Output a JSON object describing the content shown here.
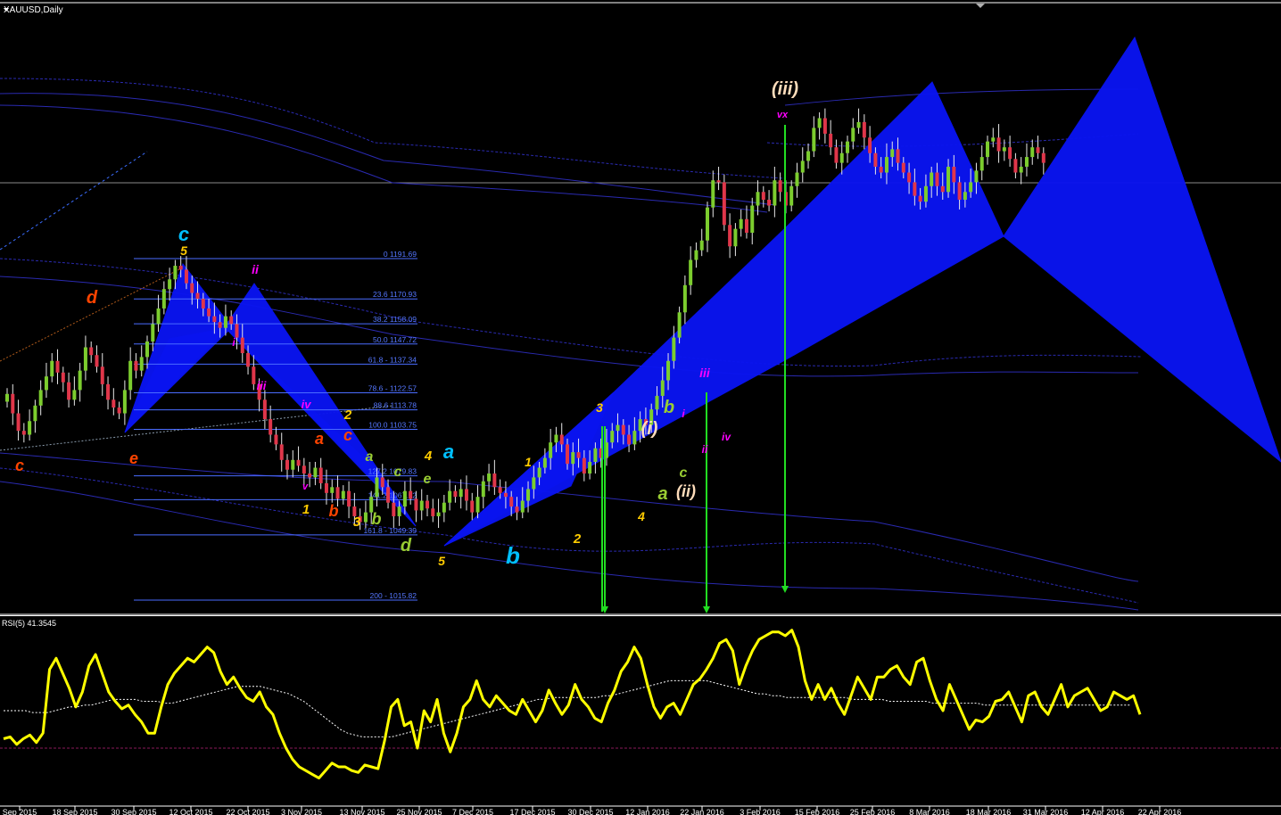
{
  "chart_data": {
    "type": "candlestick",
    "title": "XAUUSD,Daily",
    "symbol": "XAUUSD",
    "timeframe": "Daily",
    "ylim": [
      1000,
      1300
    ],
    "current_price": 1240,
    "x_tick_labels": [
      "Sep 2015",
      "18 Sep 2015",
      "30 Sep 2015",
      "12 Oct 2015",
      "22 Oct 2015",
      "3 Nov 2015",
      "13 Nov 2015",
      "25 Nov 2015",
      "7 Dec 2015",
      "17 Dec 2015",
      "30 Dec 2015",
      "12 Jan 2016",
      "22 Jan 2016",
      "3 Feb 2016",
      "15 Feb 2016",
      "25 Feb 2016",
      "8 Mar 2016",
      "18 Mar 2016",
      "31 Mar 2016",
      "12 Apr 2016",
      "22 Apr 2016"
    ],
    "fib_levels": [
      {
        "label": "0 1191.69",
        "value": 1191.69
      },
      {
        "label": "23.6 1170.93",
        "value": 1170.93
      },
      {
        "label": "38.2 1158.09",
        "value": 1158.09
      },
      {
        "label": "50.0 1147.72",
        "value": 1147.72
      },
      {
        "label": "61.8 - 1137.34",
        "value": 1137.34
      },
      {
        "label": "78.6 - 1122.57",
        "value": 1122.57
      },
      {
        "label": "88.6 1113.78",
        "value": 1113.78
      },
      {
        "label": "100.0 1103.75",
        "value": 1103.75
      },
      {
        "label": "127.2 1079.83",
        "value": 1079.83
      },
      {
        "label": "141.2 1067.52",
        "value": 1067.52
      },
      {
        "label": "161.8 - 1049.39",
        "value": 1049.39
      },
      {
        "label": "200 - 1015.82",
        "value": 1015.82
      }
    ],
    "candles_close": [
      1122,
      1112,
      1103,
      1101,
      1108,
      1116,
      1124,
      1131,
      1139,
      1133,
      1128,
      1119,
      1124,
      1134,
      1146,
      1142,
      1136,
      1127,
      1119,
      1115,
      1112,
      1124,
      1139,
      1134,
      1141,
      1149,
      1158,
      1166,
      1176,
      1181,
      1188,
      1186,
      1179,
      1174,
      1171,
      1166,
      1162,
      1159,
      1156,
      1162,
      1158,
      1151,
      1143,
      1136,
      1127,
      1119,
      1109,
      1101,
      1096,
      1088,
      1083,
      1088,
      1085,
      1081,
      1079,
      1084,
      1076,
      1071,
      1074,
      1068,
      1072,
      1064,
      1059,
      1056,
      1061,
      1069,
      1079,
      1074,
      1066,
      1059,
      1064,
      1072,
      1068,
      1062,
      1067,
      1063,
      1059,
      1061,
      1066,
      1072,
      1069,
      1073,
      1067,
      1061,
      1069,
      1077,
      1081,
      1074,
      1071,
      1069,
      1064,
      1061,
      1067,
      1073,
      1079,
      1084,
      1089,
      1097,
      1101,
      1096,
      1086,
      1092,
      1089,
      1081,
      1087,
      1094,
      1089,
      1097,
      1103,
      1106,
      1101,
      1096,
      1103,
      1109,
      1106,
      1114,
      1121,
      1129,
      1139,
      1151,
      1164,
      1178,
      1191,
      1196,
      1201,
      1218,
      1232,
      1231,
      1209,
      1198,
      1207,
      1212,
      1205,
      1219,
      1226,
      1222,
      1219,
      1232,
      1226,
      1219,
      1229,
      1236,
      1242,
      1247,
      1259,
      1264,
      1256,
      1249,
      1241,
      1246,
      1252,
      1259,
      1262,
      1254,
      1246,
      1239,
      1236,
      1244,
      1248,
      1241,
      1236,
      1231,
      1224,
      1221,
      1229,
      1236,
      1229,
      1226,
      1239,
      1231,
      1222,
      1226,
      1231,
      1237,
      1244,
      1252,
      1254,
      1247,
      1249,
      1243,
      1236,
      1239,
      1244,
      1249,
      1246,
      1241
    ],
    "wave_labels": [
      {
        "text": "c",
        "color": "#ff4400"
      },
      {
        "text": "e",
        "color": "#ff4400"
      },
      {
        "text": "d",
        "color": "#ff4400"
      },
      {
        "text": "c",
        "color": "#00bfff"
      },
      {
        "text": "5",
        "color": "#ffcc00"
      },
      {
        "text": "ii",
        "color": "#ff00ff"
      },
      {
        "text": "i",
        "color": "#ff00ff"
      },
      {
        "text": "iii",
        "color": "#ff00ff"
      },
      {
        "text": "iv",
        "color": "#ff00ff"
      },
      {
        "text": "v",
        "color": "#ff00ff"
      },
      {
        "text": "1",
        "color": "#ffcc00"
      },
      {
        "text": "a",
        "color": "#ff4400"
      },
      {
        "text": "b",
        "color": "#ff4400"
      },
      {
        "text": "c",
        "color": "#ff4400"
      },
      {
        "text": "2",
        "color": "#ffcc00"
      },
      {
        "text": "3",
        "color": "#ffcc00"
      },
      {
        "text": "a",
        "color": "#99cc33"
      },
      {
        "text": "b",
        "color": "#99cc33"
      },
      {
        "text": "c",
        "color": "#99cc33"
      },
      {
        "text": "d",
        "color": "#99cc33"
      },
      {
        "text": "e",
        "color": "#99cc33"
      },
      {
        "text": "4",
        "color": "#ffcc00"
      },
      {
        "text": "5",
        "color": "#ffcc00"
      },
      {
        "text": "a",
        "color": "#00bfff"
      },
      {
        "text": "b",
        "color": "#00bfff"
      },
      {
        "text": "1",
        "color": "#ffcc00"
      },
      {
        "text": "2",
        "color": "#ffcc00"
      },
      {
        "text": "3",
        "color": "#ffcc00"
      },
      {
        "text": "4",
        "color": "#ffcc00"
      },
      {
        "text": "(i)",
        "color": "#ffddbb"
      },
      {
        "text": "b",
        "color": "#99cc33"
      },
      {
        "text": "a",
        "color": "#99cc33"
      },
      {
        "text": "c",
        "color": "#99cc33"
      },
      {
        "text": "(ii)",
        "color": "#ffddbb"
      },
      {
        "text": "i",
        "color": "#ff00ff"
      },
      {
        "text": "ii",
        "color": "#ff00ff"
      },
      {
        "text": "iii",
        "color": "#ff00ff"
      },
      {
        "text": "iv",
        "color": "#ff00ff"
      },
      {
        "text": "vx",
        "color": "#ff00ff"
      },
      {
        "text": "(iii)",
        "color": "#ffddbb"
      }
    ],
    "rsi": {
      "label": "RSI(5) 41.3545",
      "period": 5,
      "last_value": 41.3545,
      "ylim": [
        0,
        100
      ],
      "level": 30,
      "values": [
        35,
        36,
        32,
        35,
        37,
        33,
        38,
        72,
        78,
        70,
        62,
        52,
        60,
        74,
        80,
        70,
        60,
        55,
        51,
        53,
        48,
        44,
        38,
        38,
        52,
        64,
        70,
        74,
        78,
        76,
        80,
        84,
        81,
        71,
        64,
        68,
        62,
        57,
        55,
        60,
        52,
        48,
        38,
        30,
        24,
        20,
        18,
        16,
        14,
        18,
        22,
        20,
        20,
        18,
        17,
        21,
        20,
        19,
        34,
        52,
        56,
        42,
        44,
        30,
        50,
        44,
        56,
        38,
        28,
        38,
        52,
        56,
        66,
        56,
        52,
        58,
        54,
        50,
        48,
        56,
        50,
        44,
        50,
        61,
        54,
        48,
        53,
        64,
        56,
        52,
        46,
        44,
        54,
        61,
        71,
        76,
        84,
        78,
        64,
        52,
        46,
        52,
        54,
        48,
        56,
        64,
        67,
        72,
        78,
        86,
        88,
        82,
        64,
        74,
        82,
        88,
        90,
        92,
        92,
        90,
        93,
        84,
        66,
        56,
        64,
        56,
        62,
        54,
        48,
        58,
        68,
        62,
        56,
        68,
        68,
        72,
        74,
        68,
        64,
        76,
        78,
        66,
        56,
        50,
        64,
        56,
        48,
        40,
        45,
        44,
        47,
        55,
        56,
        60,
        52,
        44,
        58,
        60,
        52,
        48,
        56,
        64,
        52,
        58,
        60,
        62,
        56,
        50,
        52,
        60,
        58,
        56,
        58,
        48
      ],
      "signal": [
        50,
        50,
        50,
        50,
        49,
        49,
        49,
        50,
        51,
        52,
        52,
        53,
        53,
        54,
        55,
        56,
        56,
        56,
        56,
        55,
        55,
        55,
        54,
        54,
        55,
        56,
        57,
        58,
        59,
        60,
        61,
        62,
        63,
        63,
        63,
        63,
        62,
        61,
        60,
        59,
        57,
        55,
        52,
        49,
        46,
        43,
        40,
        38,
        37,
        36,
        36,
        36,
        36,
        36,
        37,
        38,
        39,
        40,
        41,
        42,
        43,
        44,
        45,
        46,
        47,
        48,
        49,
        50,
        51,
        52,
        53,
        54,
        55,
        56,
        56,
        57,
        57,
        57,
        57,
        57,
        57,
        57,
        58,
        58,
        59,
        60,
        61,
        62,
        63,
        64,
        65,
        66,
        66,
        66,
        66,
        66,
        66,
        65,
        64,
        63,
        62,
        61,
        60,
        59,
        59,
        58,
        58,
        57,
        57,
        57,
        57,
        57,
        57,
        57,
        57,
        57,
        56,
        56,
        56,
        56,
        56,
        55,
        55,
        55,
        55,
        55,
        55,
        54,
        54,
        54,
        54,
        54,
        54,
        54,
        53,
        53,
        53,
        53,
        53,
        53,
        53,
        53,
        53,
        53,
        53,
        53,
        53,
        53,
        53,
        53,
        53,
        53,
        53,
        53,
        53
      ]
    }
  }
}
